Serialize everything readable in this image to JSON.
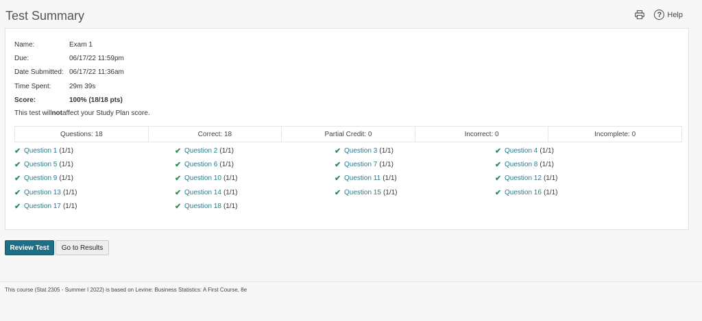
{
  "page": {
    "title": "Test Summary"
  },
  "header": {
    "help_label": "Help",
    "print_icon": "print-icon",
    "help_icon": "help-circle-icon"
  },
  "info": {
    "name_label": "Name:",
    "name": "Exam 1",
    "due_label": "Due:",
    "due": "06/17/22 11:59pm",
    "submitted_label": "Date Submitted:",
    "submitted": "06/17/22 11:36am",
    "time_label": "Time Spent:",
    "time": "29m 39s",
    "score_label": "Score:",
    "score": "100% (18/18 pts)",
    "note_prefix": "This test will ",
    "note_bold": "not",
    "note_suffix": " affect your Study Plan score."
  },
  "stats": [
    "Questions: 18",
    "Correct: 18",
    "Partial Credit: 0",
    "Incorrect: 0",
    "Incomplete: 0"
  ],
  "questions": [
    {
      "label": "Question 1",
      "score": "(1/1)"
    },
    {
      "label": "Question 2",
      "score": "(1/1)"
    },
    {
      "label": "Question 3",
      "score": "(1/1)"
    },
    {
      "label": "Question 4",
      "score": "(1/1)"
    },
    {
      "label": "Question 5",
      "score": "(1/1)"
    },
    {
      "label": "Question 6",
      "score": "(1/1)"
    },
    {
      "label": "Question 7",
      "score": "(1/1)"
    },
    {
      "label": "Question 8",
      "score": "(1/1)"
    },
    {
      "label": "Question 9",
      "score": "(1/1)"
    },
    {
      "label": "Question 10",
      "score": "(1/1)"
    },
    {
      "label": "Question 11",
      "score": "(1/1)"
    },
    {
      "label": "Question 12",
      "score": "(1/1)"
    },
    {
      "label": "Question 13",
      "score": "(1/1)"
    },
    {
      "label": "Question 14",
      "score": "(1/1)"
    },
    {
      "label": "Question 15",
      "score": "(1/1)"
    },
    {
      "label": "Question 16",
      "score": "(1/1)"
    },
    {
      "label": "Question 17",
      "score": "(1/1)"
    },
    {
      "label": "Question 18",
      "score": "(1/1)"
    }
  ],
  "buttons": {
    "review": "Review Test",
    "results": "Go to Results"
  },
  "footer": {
    "text": "This course (Stat 2305 - Summer I 2022) is based on Levine: Business Statistics: A First Course, 8e"
  },
  "colors": {
    "accent": "#1e6f86",
    "link": "#2a7a8a",
    "check": "#2e8b57"
  }
}
